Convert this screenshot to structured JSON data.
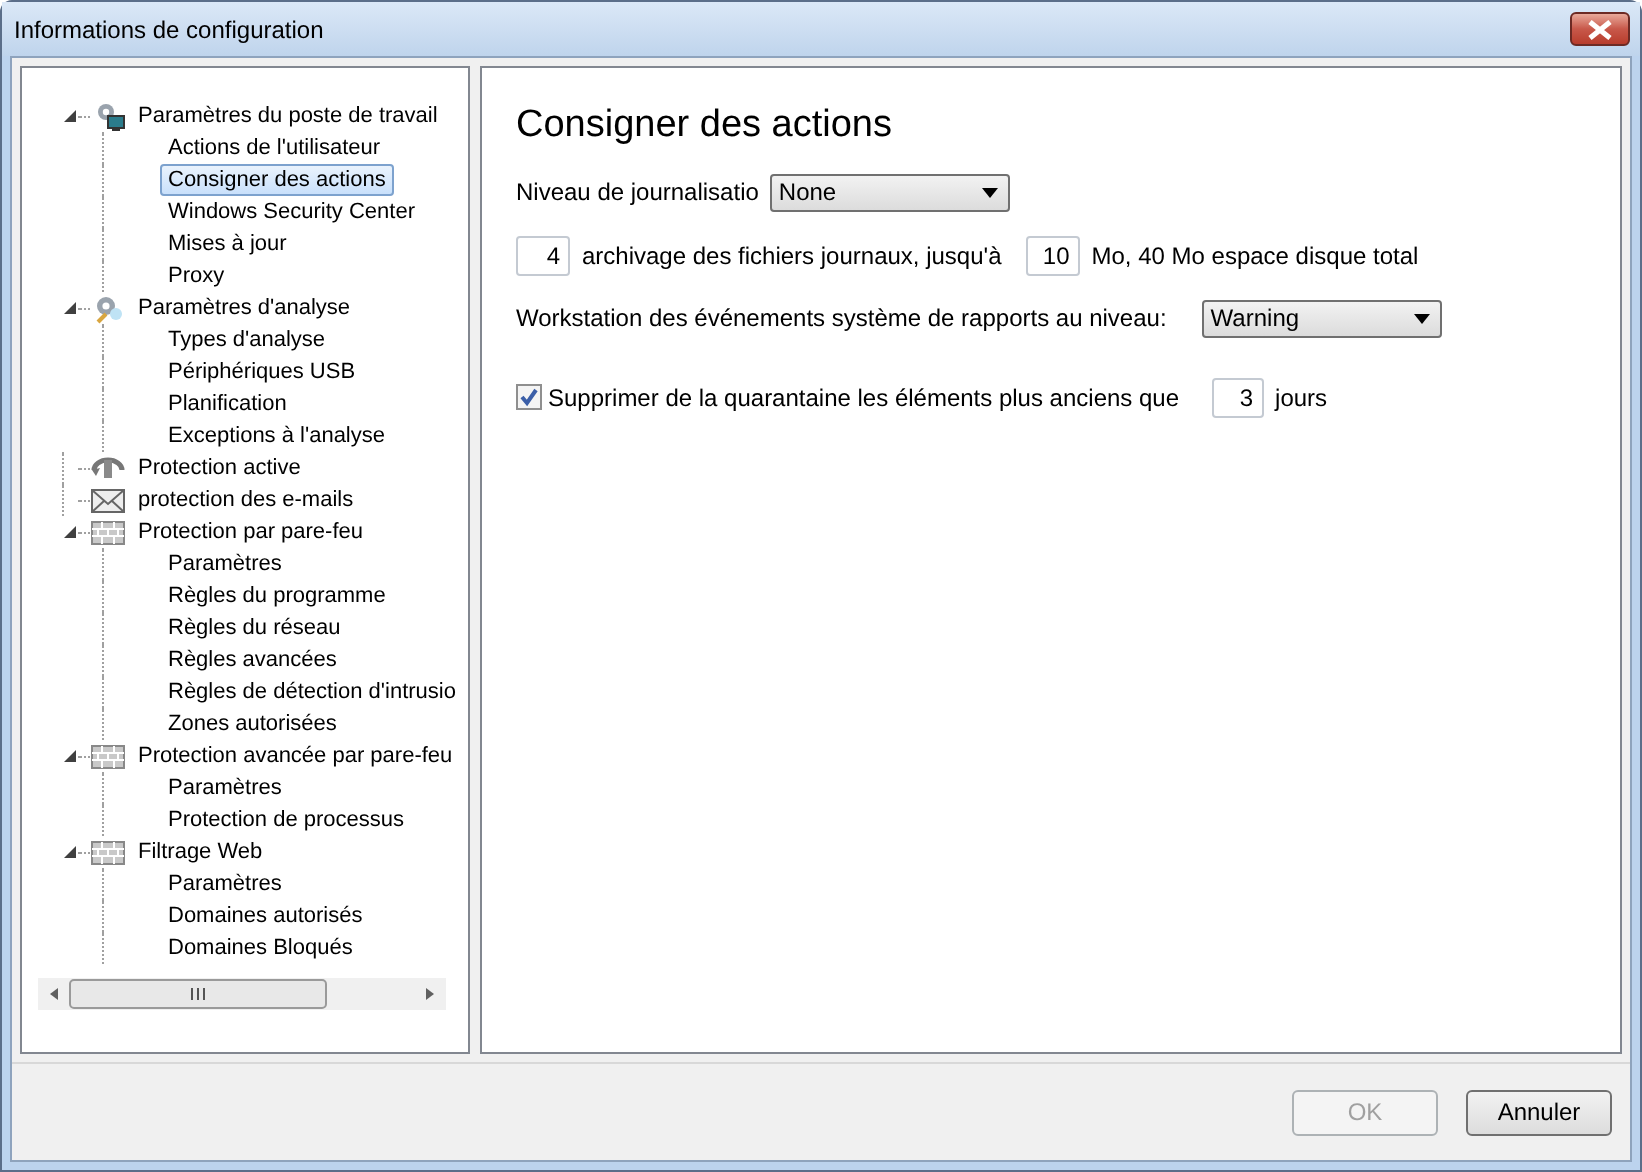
{
  "window": {
    "title": "Informations de configuration"
  },
  "tree": [
    {
      "label": "Paramètres du poste de travail",
      "kind": "workstation",
      "expanded": true,
      "selected": false,
      "children": [
        {
          "label": "Actions de l'utilisateur",
          "selected": false
        },
        {
          "label": "Consigner des actions",
          "selected": true
        },
        {
          "label": "Windows Security Center",
          "selected": false
        },
        {
          "label": "Mises à jour",
          "selected": false
        },
        {
          "label": "Proxy",
          "selected": false
        }
      ]
    },
    {
      "label": "Paramètres d'analyse",
      "kind": "analysis",
      "expanded": true,
      "selected": false,
      "children": [
        {
          "label": "Types d'analyse",
          "selected": false
        },
        {
          "label": "Périphériques USB",
          "selected": false
        },
        {
          "label": "Planification",
          "selected": false
        },
        {
          "label": "Exceptions à l'analyse",
          "selected": false
        }
      ]
    },
    {
      "label": "Protection active",
      "kind": "active",
      "selected": false
    },
    {
      "label": "protection des e-mails",
      "kind": "mail",
      "selected": false
    },
    {
      "label": "Protection par pare-feu",
      "kind": "firewall",
      "expanded": true,
      "selected": false,
      "children": [
        {
          "label": "Paramètres",
          "selected": false
        },
        {
          "label": "Règles du programme",
          "selected": false
        },
        {
          "label": "Règles du réseau",
          "selected": false
        },
        {
          "label": "Règles avancées",
          "selected": false
        },
        {
          "label": "Règles de détection d'intrusio",
          "selected": false
        },
        {
          "label": "Zones autorisées",
          "selected": false
        }
      ]
    },
    {
      "label": "Protection avancée par pare-feu",
      "kind": "firewall",
      "expanded": true,
      "selected": false,
      "children": [
        {
          "label": "Paramètres",
          "selected": false
        },
        {
          "label": "Protection de processus",
          "selected": false
        }
      ]
    },
    {
      "label": "Filtrage Web",
      "kind": "firewall",
      "expanded": true,
      "selected": false,
      "children": [
        {
          "label": "Paramètres",
          "selected": false
        },
        {
          "label": "Domaines autorisés",
          "selected": false
        },
        {
          "label": "Domaines Bloqués",
          "selected": false
        }
      ]
    }
  ],
  "panel": {
    "title": "Consigner des actions",
    "log_level": {
      "label": "Niveau de journalisatio",
      "value": "None"
    },
    "archive": {
      "count": "4",
      "text": "archivage des fichiers journaux, jusqu'à",
      "size": "10",
      "suffix": "Mo, 40 Mo espace disque total"
    },
    "events": {
      "label": "Workstation des événements système de rapports au niveau:",
      "value": "Warning"
    },
    "quarantine": {
      "checked": true,
      "label": "Supprimer de la quarantaine les éléments plus anciens que",
      "days": "3",
      "unit": "jours"
    }
  },
  "buttons": [
    {
      "label": "OK",
      "disabled": true
    },
    {
      "label": "Annuler",
      "disabled": false
    }
  ]
}
